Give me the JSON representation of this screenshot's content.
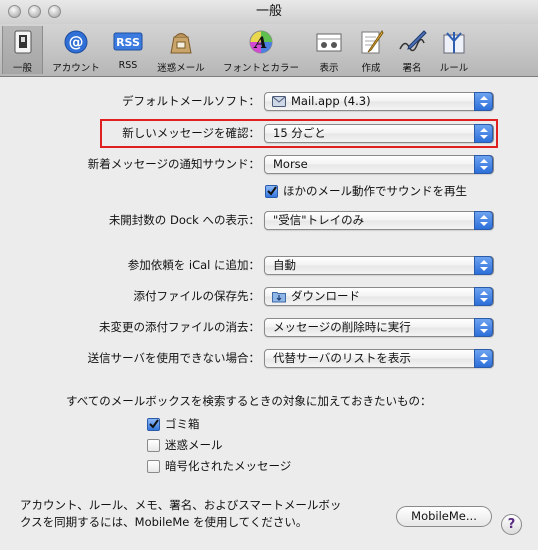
{
  "window": {
    "title": "一般"
  },
  "toolbar": {
    "items": [
      {
        "label": "一般",
        "icon": "general-switch-icon",
        "selected": true
      },
      {
        "label": "アカウント",
        "icon": "at-sign-icon"
      },
      {
        "label": "RSS",
        "icon": "rss-icon",
        "icon_text": "RSS"
      },
      {
        "label": "迷惑メール",
        "icon": "junk-mail-bag-icon"
      },
      {
        "label": "フォントとカラー",
        "icon": "font-color-icon",
        "icon_text": "A"
      },
      {
        "label": "表示",
        "icon": "viewing-icon"
      },
      {
        "label": "作成",
        "icon": "composing-icon"
      },
      {
        "label": "署名",
        "icon": "signature-icon"
      },
      {
        "label": "ルール",
        "icon": "rules-icon"
      }
    ]
  },
  "settings": {
    "default_email": {
      "label": "デフォルトメールソフト：",
      "value": "Mail.app (4.3)"
    },
    "check_new": {
      "label": "新しいメッセージを確認：",
      "value": "15 分ごと"
    },
    "new_sound": {
      "label": "新着メッセージの通知サウンド：",
      "value": "Morse"
    },
    "play_sounds": {
      "label": "ほかのメール動作でサウンドを再生",
      "checked": true
    },
    "dock_unread": {
      "label": "未開封数の Dock への表示：",
      "value": "\"受信\"トレイのみ"
    },
    "ical_invites": {
      "label": "参加依頼を iCal に追加：",
      "value": "自動"
    },
    "downloads_folder": {
      "label": "添付ファイルの保存先：",
      "value": "ダウンロード"
    },
    "remove_attachments": {
      "label": "未変更の添付ファイルの消去：",
      "value": "メッセージの削除時に実行"
    },
    "outgoing_unavailable": {
      "label": "送信サーバを使用できない場合：",
      "value": "代替サーバのリストを表示"
    }
  },
  "search": {
    "heading": "すべてのメールボックスを検索するときの対象に加えておきたいもの：",
    "options": [
      {
        "label": "ゴミ箱",
        "checked": true
      },
      {
        "label": "迷惑メール",
        "checked": false
      },
      {
        "label": "暗号化されたメッセージ",
        "checked": false
      }
    ]
  },
  "mobileme": {
    "text_line1": "アカウント、ルール、メモ、署名、およびスマートメールボッ",
    "text_line2": "クスを同期するには、MobileMe を使用してください。",
    "button_label": "MobileMe..."
  },
  "colors": {
    "highlight": "#e02020",
    "accent": "#3577de"
  }
}
